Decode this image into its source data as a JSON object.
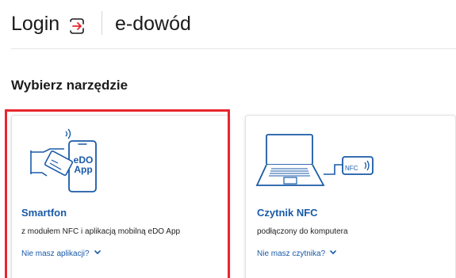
{
  "header": {
    "login_label": "Login",
    "edowod_label": "e-dowód"
  },
  "section_title": "Wybierz narzędzie",
  "cards": [
    {
      "id": "smartfon",
      "title": "Smartfon",
      "description": "z modułem NFC i aplikacją mobilną eDO App",
      "link_text": "Nie masz aplikacji?",
      "app_line1": "eDO",
      "app_line2": "App",
      "selected": true
    },
    {
      "id": "nfc",
      "title": "Czytnik NFC",
      "description": "podłączony do komputera",
      "link_text": "Nie masz czytnika?",
      "nfc_badge": "NFC",
      "selected": false
    }
  ],
  "colors": {
    "accent": "#1a5aa8",
    "selected_border": "#e8262c",
    "login_icon_red": "#e8262c"
  }
}
